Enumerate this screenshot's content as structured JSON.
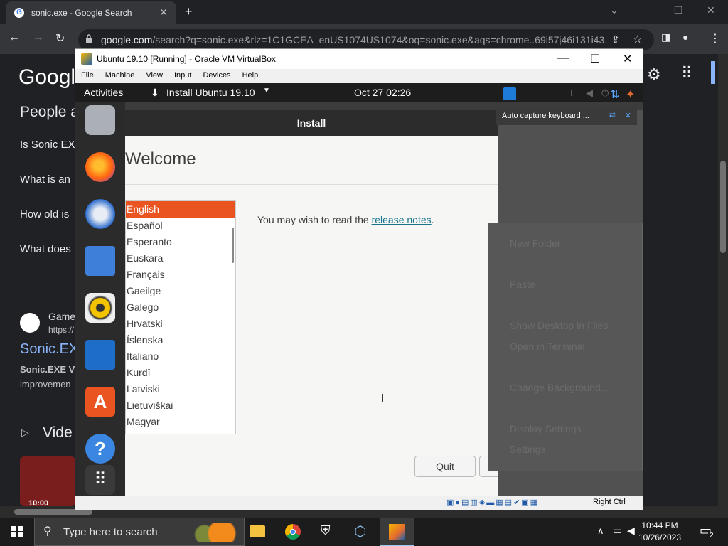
{
  "chrome": {
    "tab_title": "sonic.exe - Google Search",
    "url_host": "google.com",
    "url_rest": "/search?q=sonic.exe&rlz=1C1GCEA_enUS1074US1074&oq=sonic.exe&aqs=chrome..69i57j46i131i43..."
  },
  "google": {
    "logo": "Google",
    "people_also_ask": "People a",
    "questions": [
      "Is Sonic EX",
      "What is an",
      "How old is",
      "What does"
    ],
    "result_source": "Game",
    "result_url": "https://",
    "result_title": "Sonic.EX",
    "result_snippet_1": "Sonic.EXE V",
    "result_snippet_2": "improvemen",
    "videos_label": "Vide",
    "video_duration": "10:00"
  },
  "vbox": {
    "title": "Ubuntu 19.10 [Running] - Oracle VM VirtualBox",
    "menu": [
      "File",
      "Machine",
      "View",
      "Input",
      "Devices",
      "Help"
    ],
    "host_key": "Right Ctrl"
  },
  "ubuntu": {
    "activities": "Activities",
    "app_menu": "Install Ubuntu 19.10",
    "clock": "Oct 27  02:26",
    "window_title": "Install",
    "welcome": "Welcome",
    "languages": [
      "English",
      "Español",
      "Esperanto",
      "Euskara",
      "Français",
      "Gaeilge",
      "Galego",
      "Hrvatski",
      "Íslenska",
      "Italiano",
      "Kurdî",
      "Latviski",
      "Lietuviškai",
      "Magyar"
    ],
    "selected_language": "English",
    "release_prefix": "You may wish to read the ",
    "release_link": "release notes",
    "release_suffix": ".",
    "quit_label": "Quit",
    "notification": "Auto capture keyboard ...",
    "context_menu": {
      "new_folder": "New Folder",
      "paste": "Paste",
      "show_desktop": "Show Desktop in Files",
      "open_terminal": "Open in Terminal",
      "change_background": "Change Background...",
      "display_settings": "Display Settings",
      "settings": "Settings"
    }
  },
  "taskbar": {
    "search_placeholder": "Type here to search",
    "time": "10:44 PM",
    "date": "10/26/2023",
    "notification_count": "2"
  },
  "colors": {
    "ubuntu_orange": "#e95420",
    "link": "#19758e",
    "chrome_dark": "#202124"
  }
}
